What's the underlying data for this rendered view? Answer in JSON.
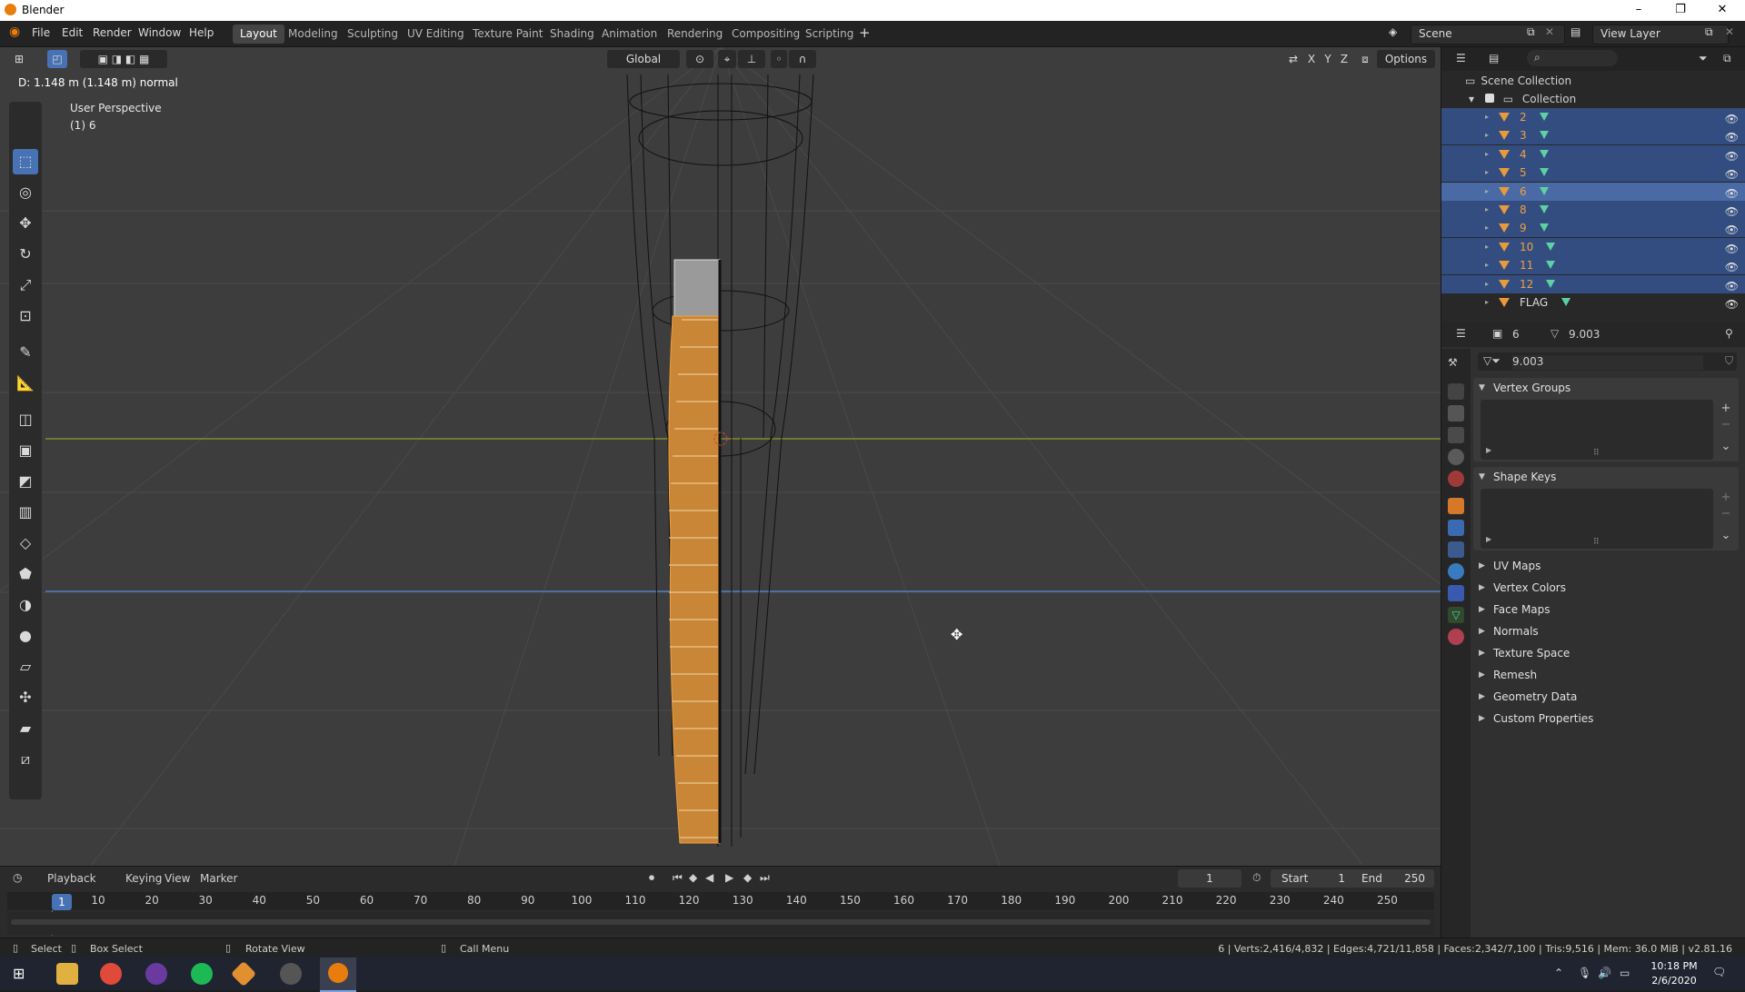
{
  "window": {
    "title": "Blender",
    "minimize": "–",
    "maximize": "❐",
    "close": "✕"
  },
  "menus": [
    "File",
    "Edit",
    "Render",
    "Window",
    "Help"
  ],
  "workspaces": [
    "Layout",
    "Modeling",
    "Sculpting",
    "UV Editing",
    "Texture Paint",
    "Shading",
    "Animation",
    "Rendering",
    "Compositing",
    "Scripting"
  ],
  "active_workspace": "Layout",
  "scene": {
    "label": "Scene",
    "view_layer": "View Layer"
  },
  "viewport": {
    "transform_orientation": "Global",
    "options_label": "Options",
    "axes": [
      "X",
      "Y",
      "Z"
    ],
    "status_message": "D: 1.148 m (1.148 m) normal",
    "perspective": "User Perspective",
    "object_info": "(1) 6"
  },
  "outliner": {
    "scene_collection": "Scene Collection",
    "collection": "Collection",
    "items": [
      {
        "name": "2",
        "selected": true,
        "active": false
      },
      {
        "name": "3",
        "selected": true,
        "active": false
      },
      {
        "name": "4",
        "selected": true,
        "active": false
      },
      {
        "name": "5",
        "selected": true,
        "active": false
      },
      {
        "name": "6",
        "selected": true,
        "active": true
      },
      {
        "name": "8",
        "selected": true,
        "active": false
      },
      {
        "name": "9",
        "selected": true,
        "active": false
      },
      {
        "name": "10",
        "selected": true,
        "active": false
      },
      {
        "name": "11",
        "selected": true,
        "active": false
      },
      {
        "name": "12",
        "selected": true,
        "active": false
      },
      {
        "name": "FLAG",
        "selected": false,
        "active": false
      }
    ]
  },
  "properties": {
    "object_name": "6",
    "mesh_name": "9.003",
    "datablock_name": "9.003",
    "panels_open": [
      "Vertex Groups",
      "Shape Keys"
    ],
    "panels_collapsed": [
      "UV Maps",
      "Vertex Colors",
      "Face Maps",
      "Normals",
      "Texture Space",
      "Remesh",
      "Geometry Data",
      "Custom Properties"
    ]
  },
  "timeline": {
    "menus": [
      "Playback",
      "Keying",
      "View",
      "Marker"
    ],
    "current_frame": "1",
    "start_label": "Start",
    "start_value": "1",
    "end_label": "End",
    "end_value": "250",
    "ticks": [
      "10",
      "20",
      "30",
      "40",
      "50",
      "60",
      "70",
      "80",
      "90",
      "100",
      "110",
      "120",
      "130",
      "140",
      "150",
      "160",
      "170",
      "180",
      "190",
      "200",
      "210",
      "220",
      "230",
      "240",
      "250"
    ],
    "playhead_label": "1"
  },
  "statusbar": {
    "select": "Select",
    "box_select": "Box Select",
    "rotate_view": "Rotate View",
    "call_menu": "Call Menu",
    "stats": "6 | Verts:2,416/4,832 | Edges:4,721/11,858 | Faces:2,342/7,100 | Tris:9,516 | Mem: 36.0 MiB | v2.81.16"
  },
  "taskbar": {
    "time": "10:18 PM",
    "date": "2/6/2020"
  },
  "colors": {
    "accent": "#4772b3",
    "selection": "#334d80",
    "active_row": "#4a6aa5",
    "object_orange": "#e89a3c",
    "mesh_green": "#5dd1a2",
    "x_axis": "#8a9a3a",
    "y_axis": "#4f7fbf"
  }
}
